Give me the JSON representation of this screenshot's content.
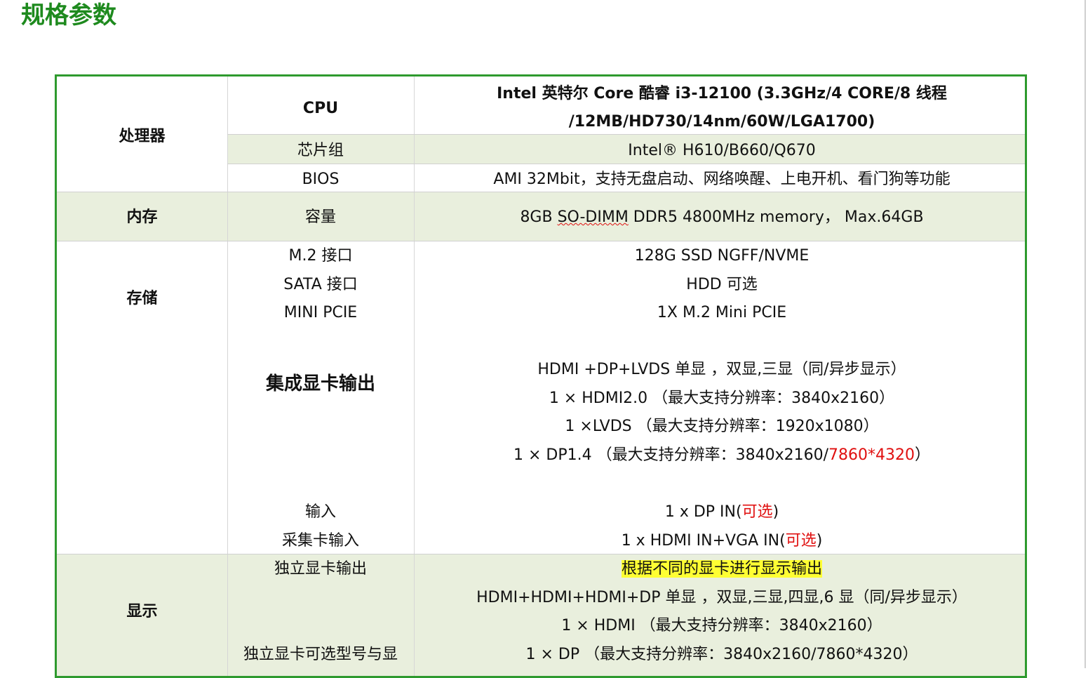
{
  "page": {
    "title": "规格参数"
  },
  "processor": {
    "category": "处理器",
    "cpu_label": "CPU",
    "cpu_value_line1": "Intel 英特尔  Core 酷睿  i3-12100 (3.3GHz/4 CORE/8 线程",
    "cpu_value_line2": "/12MB/HD730/14nm/60W/LGA1700)",
    "chipset_label": "芯片组",
    "chipset_value": "Intel® H610/B660/Q670",
    "bios_label": "BIOS",
    "bios_value": "AMI 32Mbit，支持无盘启动、网络唤醒、上电开机、看门狗等功能"
  },
  "memory": {
    "category": "内存",
    "capacity_label": "容量",
    "capacity_value_a": "8GB ",
    "capacity_value_b": "SO-DIMM",
    "capacity_value_c": " DDR5 4800MHz memory，  Max.64GB"
  },
  "storage": {
    "category": "存储",
    "m2_label": "M.2 接口",
    "m2_value": "128G SSD    NGFF/NVME",
    "sata_label": "SATA 接口",
    "sata_value": "HDD 可选",
    "minipcie_label": "MINI PCIE",
    "minipcie_value": "1X M.2 Mini PCIE",
    "igpu_label": "集成显卡输出",
    "igpu_line1": "HDMI  +DP+LVDS 单显  ，双显,三显（同/异步显示）",
    "igpu_line2": "1  ×  HDMI2.0       （最大支持分辨率：3840x2160）",
    "igpu_line3": "1  ×LVDS     （最大支持分辨率：1920x1080）",
    "igpu_line4_a": "1    ×    DP1.4       （最大支持分辨率：3840x2160/",
    "igpu_line4_red": "7860*4320",
    "igpu_line4_b": "）",
    "input_label": "输入",
    "input_value_a": "1 x DP IN(",
    "input_value_red": "可选",
    "input_value_b": ")",
    "capture_label": "采集卡输入",
    "capture_value_a": "1 x HDMI IN+VGA IN(",
    "capture_value_red": "可选",
    "capture_value_b": ")"
  },
  "display": {
    "category": "显示",
    "dgpu_label": "独立显卡输出",
    "dgpu_value": "根据不同的显卡进行显示输出",
    "dgpu_line2": "HDMI+HDMI+HDMI+DP 单显  ，双显,三显,四显,6 显（同/异步显示）",
    "dgpu_line3": "1  ×  HDMI       （最大支持分辨率：3840x2160）",
    "dgpu_model_label": "独立显卡可选型号与显",
    "dgpu_line4": "1    ×    DP      （最大支持分辨率：3840x2160/7860*4320）"
  },
  "colors": {
    "title": "#1e8a1e",
    "border": "#2e9a2e",
    "row_fill": "#e9efdd",
    "accent_red": "#e01010",
    "highlight": "#ffff33"
  }
}
